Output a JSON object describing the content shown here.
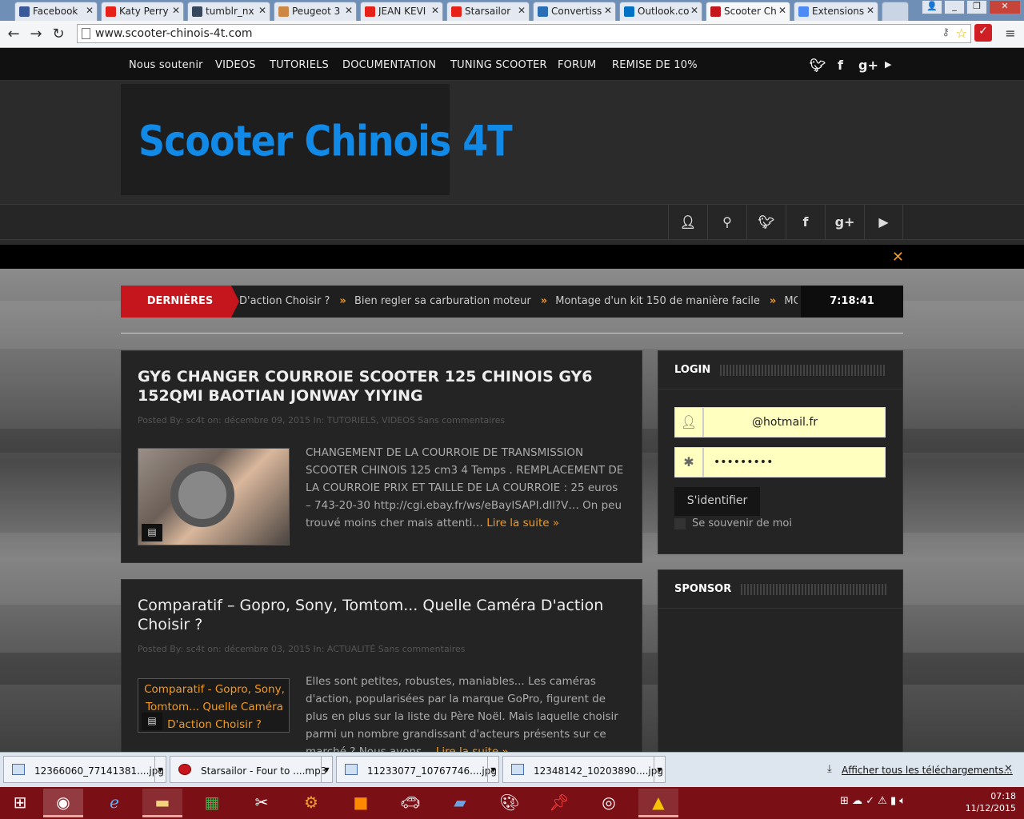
{
  "browser": {
    "tabs": [
      {
        "label": "Facebook",
        "color": "#3b5998"
      },
      {
        "label": "Katy Perry",
        "color": "#e62117"
      },
      {
        "label": "tumblr_nx",
        "color": "#36465d"
      },
      {
        "label": "Peugeot 3",
        "color": "#cc8844"
      },
      {
        "label": "JEAN KEVI",
        "color": "#e62117"
      },
      {
        "label": "Starsailor",
        "color": "#e62117"
      },
      {
        "label": "Convertiss",
        "color": "#2a6fb5"
      },
      {
        "label": "Outlook.co",
        "color": "#0072c6"
      },
      {
        "label": "Scooter Ch",
        "color": "#c4161c"
      },
      {
        "label": "Extensions",
        "color": "#4c8bf5"
      }
    ],
    "url": "www.scooter-chinois-4t.com"
  },
  "nav": {
    "items": [
      "Nous soutenir",
      "VIDEOS",
      "TUTORIELS",
      "DOCUMENTATION",
      "TUNING SCOOTER",
      "FORUM",
      "REMISE DE 10%"
    ]
  },
  "header": {
    "logo": "Scooter Chinois 4T"
  },
  "ticker": {
    "label": "DERNIÈRES",
    "items": [
      "D'action Choisir ?",
      "Bien regler sa carburation moteur",
      "Montage d'un kit 150 de manière facile",
      "MONT"
    ],
    "time": "7:18:41"
  },
  "posts": [
    {
      "title": "GY6 CHANGER COURROIE SCOOTER 125 CHINOIS GY6 152QMI BAOTIAN JONWAY YIYING",
      "meta": "Posted By: sc4t    on: décembre 09, 2015    In: TUTORIELS, VIDEOS    Sans commentaires",
      "excerpt": "CHANGEMENT DE LA COURROIE DE TRANSMISSION SCOOTER CHINOIS 125 cm3 4 Temps . REMPLACEMENT DE LA COURROIE PRIX ET TAILLE DE LA COURROIE : 25 euros – 743-20-30 http://cgi.ebay.fr/ws/eBayISAPI.dll?V… On peu trouvé moins cher mais attenti…",
      "read_more": "Lire la suite »"
    },
    {
      "title": "Comparatif – Gopro, Sony, Tomtom... Quelle Caméra D'action Choisir ?",
      "meta": "Posted By: sc4t    on: décembre 03, 2015    In: ACTUALITÉ    Sans commentaires",
      "thumb_alt": "Comparatif - Gopro, Sony, Tomtom... Quelle Caméra D'action Choisir ?",
      "excerpt": "Elles sont petites, robustes, maniables... Les caméras d'action, popularisées par la marque GoPro, figurent de plus en plus sur la liste du Père Noël. Mais laquelle choisir parmi un nombre grandissant d'acteurs présents sur ce marché ? Nous avons…",
      "read_more": "Lire la suite »"
    }
  ],
  "login": {
    "title": "LOGIN",
    "email": "@hotmail.fr",
    "password": "•••••••••",
    "button": "S'identifier",
    "remember": "Se souvenir de moi"
  },
  "sponsor": {
    "title": "SPONSOR"
  },
  "downloads": {
    "items": [
      "12366060_77141381....jpg",
      "Starsailor - Four to ....mp3",
      "11233077_10767746....jpg",
      "12348142_10203890....jpg"
    ],
    "show_all": "Afficher tous les téléchargements..."
  },
  "taskbar": {
    "time": "07:18",
    "date": "11/12/2015"
  }
}
